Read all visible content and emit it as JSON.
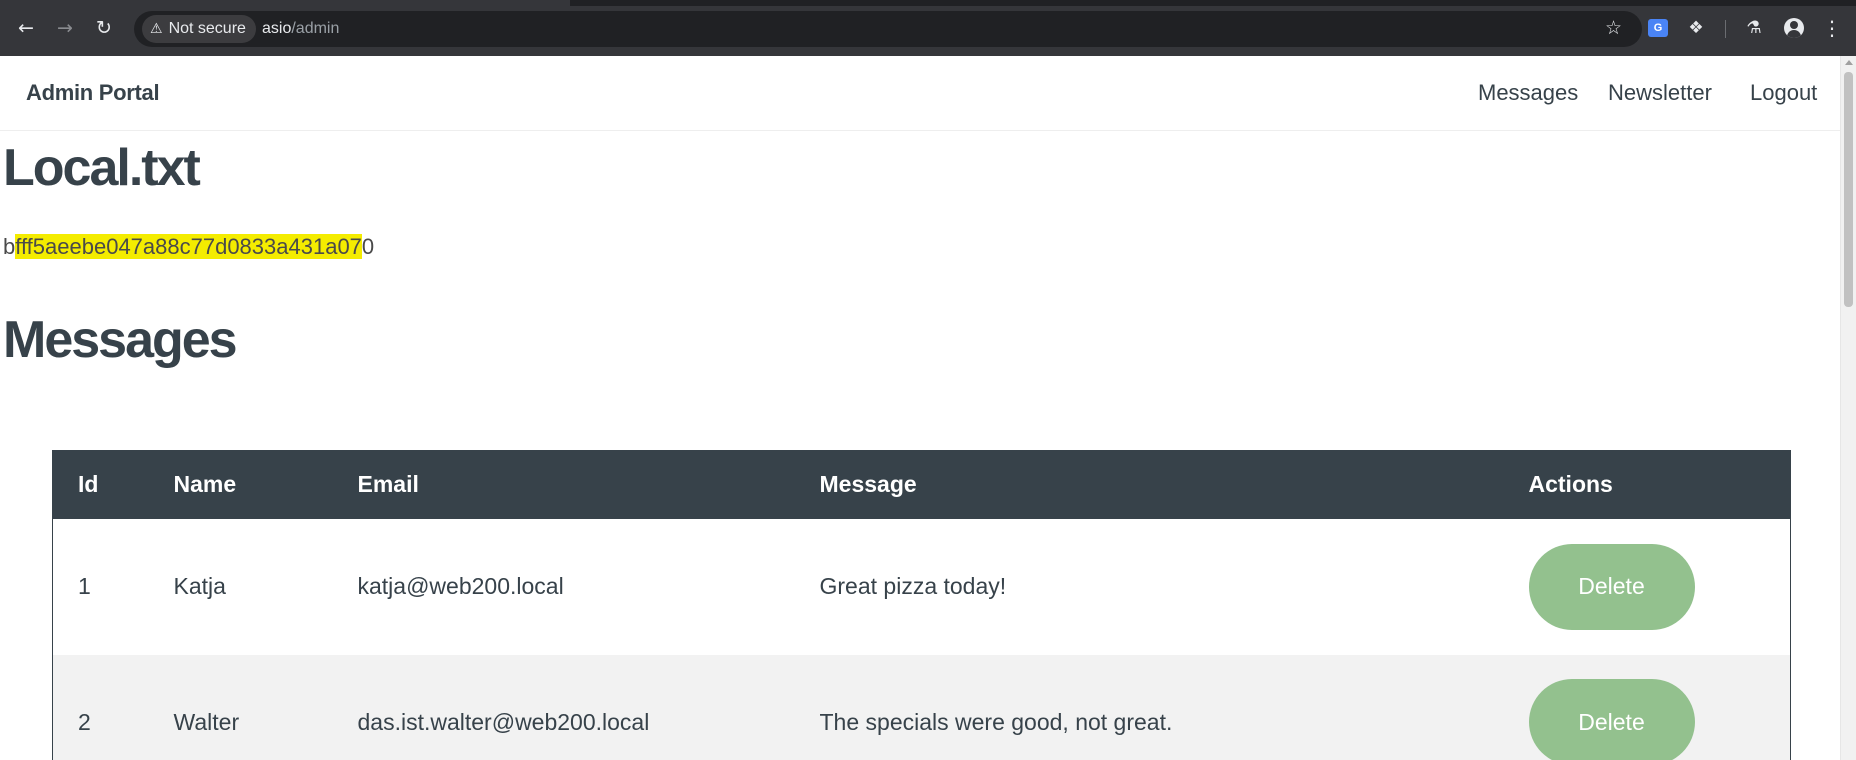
{
  "browser": {
    "security_label": "Not secure",
    "url_host": "asio",
    "url_path": "/admin",
    "icons": [
      "back-icon",
      "forward-icon",
      "reload-icon",
      "warning-icon",
      "star-icon",
      "translate-icon",
      "extensions-icon",
      "labs-icon",
      "profile-icon",
      "menu-icon"
    ]
  },
  "nav": {
    "brand": "Admin Portal",
    "links": [
      "Messages",
      "Newsletter",
      "Logout"
    ]
  },
  "local": {
    "heading": "Local.txt",
    "hash_lead": "b",
    "hash_highlight": "fff5aeebe047a88c77d0833a431a07",
    "hash_tail": "0"
  },
  "messages": {
    "heading": "Messages",
    "columns": [
      "Id",
      "Name",
      "Email",
      "Message",
      "Actions"
    ],
    "rows": [
      {
        "id": "1",
        "name": "Katja",
        "email": "katja@web200.local",
        "message": "Great pizza today!",
        "action": "Delete"
      },
      {
        "id": "2",
        "name": "Walter",
        "email": "das.ist.walter@web200.local",
        "message": "The specials were good, not great.",
        "action": "Delete"
      }
    ]
  },
  "colors": {
    "primary": "#37424a",
    "delete_button": "#93c18e",
    "highlight": "#f4ec00"
  }
}
